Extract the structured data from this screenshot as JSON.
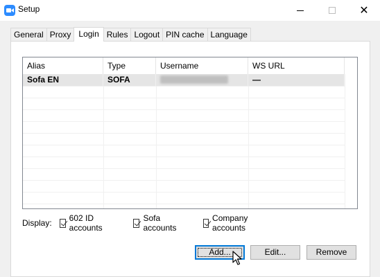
{
  "window": {
    "title": "Setup",
    "app_icon": "video-camera-icon",
    "controls": {
      "minimize": "minimize-icon",
      "maximize": "maximize-icon",
      "close_glyph": "✕"
    }
  },
  "tabs": [
    {
      "label": "General",
      "active": false
    },
    {
      "label": "Proxy",
      "active": false
    },
    {
      "label": "Login",
      "active": true
    },
    {
      "label": "Rules",
      "active": false
    },
    {
      "label": "Logout",
      "active": false
    },
    {
      "label": "PIN cache",
      "active": false
    },
    {
      "label": "Language",
      "active": false
    }
  ],
  "accounts_list": {
    "columns": [
      "Alias",
      "Type",
      "Username",
      "WS URL"
    ],
    "rows": [
      {
        "alias": "Sofa EN",
        "type": "SOFA",
        "username": "",
        "ws_url": "—",
        "selected": true
      }
    ]
  },
  "display_filter": {
    "label": "Display:",
    "options": [
      {
        "label": "602 ID accounts",
        "checked": true
      },
      {
        "label": "Sofa accounts",
        "checked": true
      },
      {
        "label": "Company accounts",
        "checked": true
      }
    ]
  },
  "buttons": {
    "add": "Add...",
    "edit": "Edit...",
    "remove": "Remove"
  },
  "colors": {
    "accent": "#2d8cff",
    "focus_border": "#0078d7",
    "selected_row": "#e5e5e5"
  }
}
